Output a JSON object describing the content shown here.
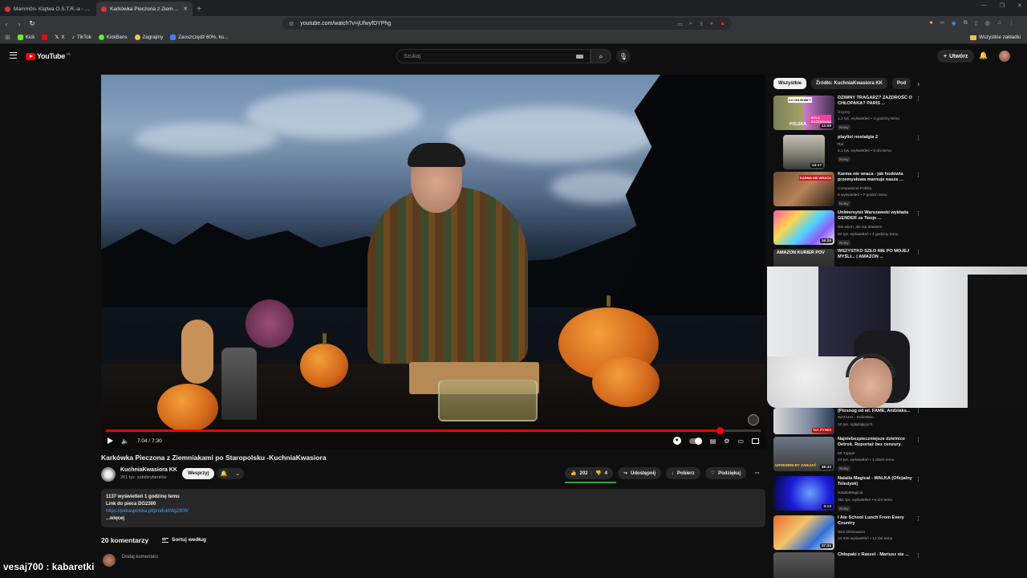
{
  "browser": {
    "tabs": [
      {
        "title": "Mamm0n- Klątwa O.S.T.R.-a - YouTube",
        "active": false
      },
      {
        "title": "Karkówka Pieczona z Ziemniakami po Staropolsku",
        "active": true
      }
    ],
    "new_tab": "+",
    "url": "youtube.com/watch?v=jUfwyfDYPhg",
    "bookmarks": [
      "Kick",
      "X",
      "TikTok",
      "KickBans",
      "Zagrajmy",
      "Zaoszczędź 60%, ku..."
    ],
    "all_bookmarks": "Wszystkie zakładki"
  },
  "masthead": {
    "logo": "YouTube",
    "logo_country": "PL",
    "search_placeholder": "Szukaj",
    "create_label": "Utwórz"
  },
  "player": {
    "time": "7:04 / 7:30",
    "progress": 0.938
  },
  "video": {
    "title": "Karkówka Pieczona z Ziemniakami po Staropolsku -KuchniaKwasiora",
    "channel": "KuchniaKwasiora KK",
    "subscribers": "261 tys. subskrybentów",
    "support_label": "Wesprzyj",
    "likes": "202",
    "dislikes": "4",
    "share_label": "Udostępnij",
    "download_label": "Pobierz",
    "thanks_label": "Podziękuj"
  },
  "description": {
    "stats": "1137 wyświetleń  1 godzinę temu",
    "line1": "Link do pieca DG2300",
    "link": "https://pekaspolska.pl/produkt/dg2300/",
    "more": "...więcej"
  },
  "comments": {
    "count_label": "20 komentarzy",
    "sort_label": "Sortuj według",
    "add_placeholder": "Dodaj komentarz"
  },
  "sidebar": {
    "chips": [
      "Wszystkie",
      "Źródło: KuchniaKwasiora KK",
      "Pod"
    ],
    "recs": [
      {
        "title": "DZIWNY TRAGARZ? ZAZDROŚĆ O CHŁOPAKA? PARIS ...",
        "channel": "izzyzzy",
        "meta": "1,2 tys. wyświetleń • 4 godziny temu",
        "badge": "Nowy",
        "duration": "13:09"
      },
      {
        "title": "playlist nostalgia 2",
        "channel": "Rai",
        "meta": "6,1 tys. wyświetleń • 6 dni temu",
        "badge": "Nowy",
        "duration": "14:17"
      },
      {
        "title": "Karma nie wraca - jak hodowla przemysłowa marnuje nasze ...",
        "channel": "Compassion Polska",
        "meta": "8 wyświetleń • 7 godzin temu",
        "badge": "Nowy",
        "duration": ""
      },
      {
        "title": "Uniwersytet Warszawski wykłada GENDER za Twoje ...",
        "channel": "Nie wiem, ale się dowiem!",
        "meta": "22 tys. wyświetleń • 4 godziny temu",
        "badge": "Nowy",
        "duration": "16:20"
      },
      {
        "title": "WSZYSTKO SZŁO NIE PO MOJEJ MYŚLI... | AMAZON ...",
        "channel": "",
        "meta": "",
        "badge": "",
        "duration": ""
      },
      {
        "title": "(Piosnog od wl. FAME, Andziaks...",
        "channel": "WATAHA - Królestwo",
        "meta": "12 tys. oglądających",
        "badge": "",
        "duration": "NA ŻYWO"
      },
      {
        "title": "Najniebezpieczniejsze dzielnice Detroit. Reportaż bez cenzury.",
        "channel": "Mr Tripper",
        "meta": "24 tys. wyświetleń • 1 dzień temu",
        "badge": "Nowy",
        "duration": "38:33"
      },
      {
        "title": "Natalia Magical - WALKA (Oficjalny Teledysk)",
        "channel": "NataliaMagical",
        "meta": "351 tys. wyświetleń • 6 dni temu",
        "badge": "Nowy",
        "duration": "3:13"
      },
      {
        "title": "I Ate School Lunch From Every Country",
        "channel": "Nick DiGiovanni",
        "meta": "14 mln wyświetleń • 12 dni temu",
        "badge": "",
        "duration": "37:31"
      },
      {
        "title": "Chłopaki z Raszel - Mariusz nie ...",
        "channel": "",
        "meta": "",
        "badge": "",
        "duration": ""
      }
    ],
    "thumb_texts": {
      "rec0_a": "CO ON ROBI?!",
      "rec0_b": "BYŁA ZAZDROSNA",
      "rec0_c": "POLSKA",
      "rec2_a": "KARMA NIE WRACA",
      "rec4_a": "AMAZON KURIER POV",
      "rec6_a": "URODZENI BY ZABIJAĆ"
    }
  },
  "stream_chat": "vesaj700 : kabaretki",
  "colors": {
    "bg": "#0f0f0f",
    "accent_red": "#ff0000",
    "link_blue": "#3ea6ff"
  }
}
